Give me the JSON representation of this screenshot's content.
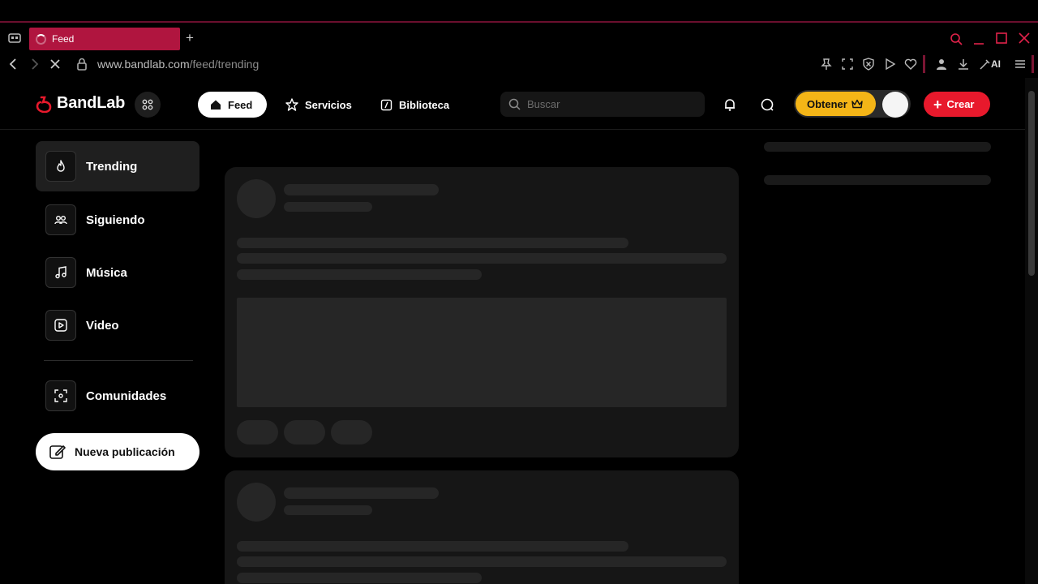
{
  "browser": {
    "tab_title": "Feed",
    "new_tab": "+",
    "url_domain": "www.bandlab.com",
    "url_path": "/feed/trending",
    "ai_label": "AI"
  },
  "header": {
    "logo_text": "BandLab",
    "nav": [
      {
        "label": "Feed"
      },
      {
        "label": "Servicios"
      },
      {
        "label": "Biblioteca"
      }
    ],
    "search_placeholder": "Buscar",
    "get_label": "Obtener",
    "create_label": "Crear"
  },
  "sidebar": {
    "items": [
      {
        "label": "Trending",
        "icon": "flame-icon",
        "active": true
      },
      {
        "label": "Siguiendo",
        "icon": "users-icon"
      },
      {
        "label": "Música",
        "icon": "music-note-icon"
      },
      {
        "label": "Video",
        "icon": "video-icon"
      },
      {
        "label": "Comunidades",
        "icon": "communities-icon"
      }
    ],
    "new_post_label": "Nueva publicación"
  },
  "colors": {
    "accent": "#e8192c",
    "tab_active": "#b0153f",
    "premium": "#f4b517"
  }
}
